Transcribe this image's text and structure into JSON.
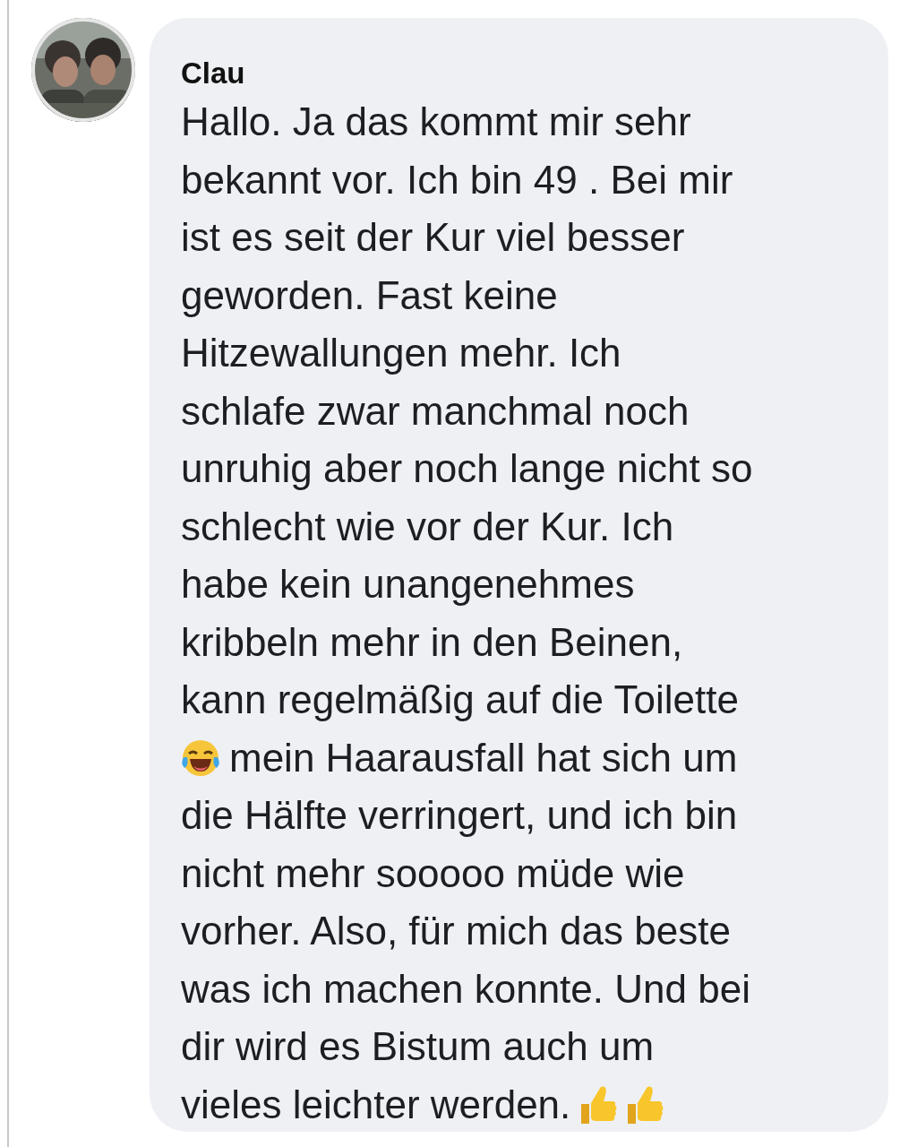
{
  "comment": {
    "author": "Clau",
    "avatar": {
      "kind": "picture"
    },
    "lines": [
      [
        {
          "kind": "text",
          "text": "Hallo. Ja das kommt mir sehr"
        }
      ],
      [
        {
          "kind": "text",
          "text": "bekannt vor. Ich bin 49 . Bei mir"
        }
      ],
      [
        {
          "kind": "text",
          "text": "ist es seit der Kur viel besser"
        }
      ],
      [
        {
          "kind": "text",
          "text": "geworden. Fast keine"
        }
      ],
      [
        {
          "kind": "text",
          "text": "Hitzewallungen mehr. Ich"
        }
      ],
      [
        {
          "kind": "text",
          "text": "schlafe zwar manchmal noch"
        }
      ],
      [
        {
          "kind": "text",
          "text": "unruhig aber noch lange nicht so"
        }
      ],
      [
        {
          "kind": "text",
          "text": "schlecht wie vor der Kur. Ich"
        }
      ],
      [
        {
          "kind": "text",
          "text": "habe kein unangenehmes"
        }
      ],
      [
        {
          "kind": "text",
          "text": "kribbeln mehr in den Beinen,"
        }
      ],
      [
        {
          "kind": "text",
          "text": "kann regelmäßig auf die Toilette"
        }
      ],
      [
        {
          "kind": "laughing_emoji"
        },
        {
          "kind": "text",
          "text": "mein Haarausfall hat sich um"
        }
      ],
      [
        {
          "kind": "text",
          "text": "die Hälfte verringert, und ich bin"
        }
      ],
      [
        {
          "kind": "text",
          "text": "nicht mehr sooooo müde wie"
        }
      ],
      [
        {
          "kind": "text",
          "text": "vorher. Also, für mich das beste"
        }
      ],
      [
        {
          "kind": "text",
          "text": "was ich machen konnte. Und bei"
        }
      ],
      [
        {
          "kind": "text",
          "text": "dir wird es Bistum auch um"
        }
      ],
      [
        {
          "kind": "text",
          "text": "vieles leichter werden."
        },
        {
          "kind": "thumbs_up_emoji"
        },
        {
          "kind": "thumbs_up_emoji"
        }
      ]
    ]
  }
}
